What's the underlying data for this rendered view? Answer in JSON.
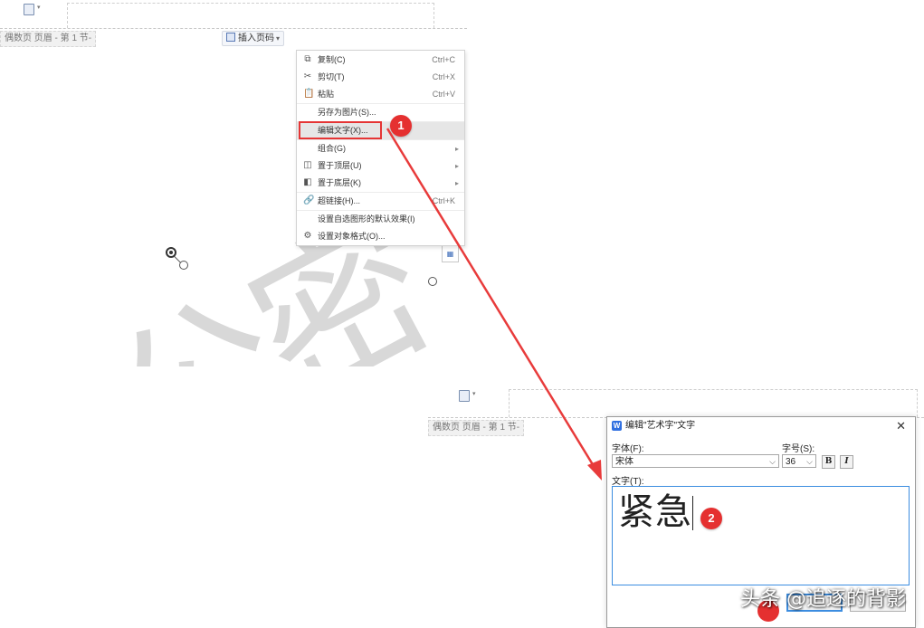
{
  "top_doc": {
    "header_tag": "偶数页 页眉 - 第 1 节-",
    "insert_page_number": "插入页码"
  },
  "context_menu": {
    "items": [
      {
        "icon": "copy-icon",
        "label": "复制(C)",
        "shortcut": "Ctrl+C"
      },
      {
        "icon": "scissors-icon",
        "label": "剪切(T)",
        "shortcut": "Ctrl+X"
      },
      {
        "icon": "paste-icon",
        "label": "粘贴",
        "shortcut": "Ctrl+V"
      },
      {
        "icon": "",
        "label": "另存为图片(S)...",
        "shortcut": ""
      },
      {
        "icon": "",
        "label": "编辑文字(X)...",
        "shortcut": ""
      },
      {
        "icon": "",
        "label": "组合(G)",
        "shortcut": ""
      },
      {
        "icon": "bring-to-front-icon",
        "label": "置于顶层(U)",
        "shortcut": ""
      },
      {
        "icon": "send-to-back-icon",
        "label": "置于底层(K)",
        "shortcut": ""
      },
      {
        "icon": "link-icon",
        "label": "超链接(H)...",
        "shortcut": "Ctrl+K"
      },
      {
        "icon": "",
        "label": "设置自选图形的默认效果(I)",
        "shortcut": ""
      },
      {
        "icon": "format-object-icon",
        "label": "设置对象格式(O)...",
        "shortcut": ""
      }
    ]
  },
  "watermark": "公密",
  "step_badges": [
    "1",
    "2"
  ],
  "bottom_doc": {
    "header_tag": "偶数页 页眉 - 第 1 节-"
  },
  "dialog": {
    "title": "编辑\"艺术字\"文字",
    "font_label": "字体(F):",
    "font_value": "宋体",
    "size_label": "字号(S):",
    "size_value": "36",
    "bold_label": "B",
    "italic_label": "I",
    "text_label": "文字(T):",
    "text_value": "紧急"
  },
  "credit": "头条 @追逐的背影",
  "colors": {
    "highlight_red": "#e53535",
    "arrow_red": "#e83b3b",
    "dialog_border_blue": "#3c8de0"
  }
}
